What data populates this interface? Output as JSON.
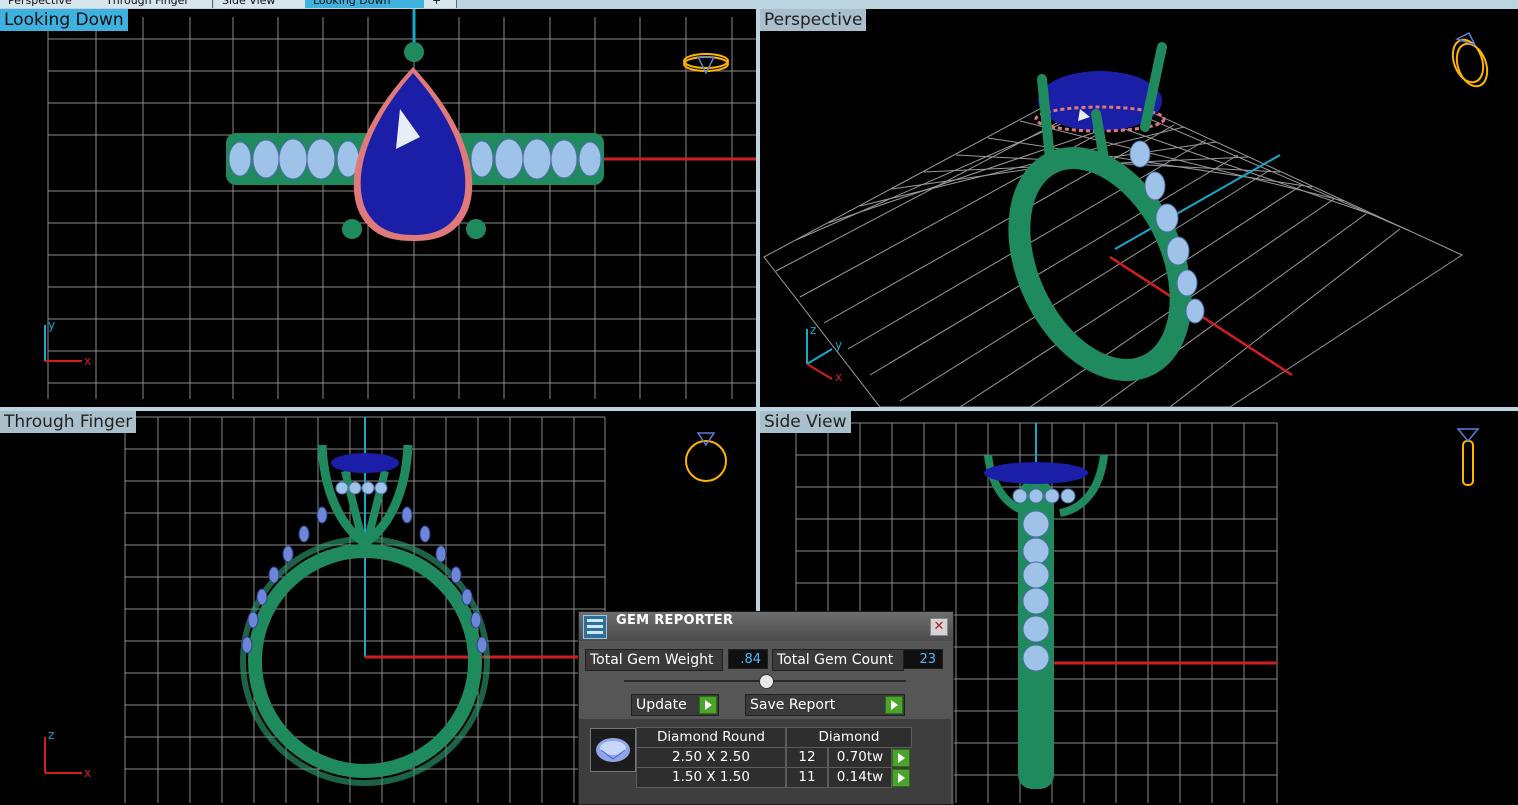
{
  "tabs": [
    {
      "label": "Perspective"
    },
    {
      "label": "Through Finger"
    },
    {
      "label": "Side View"
    },
    {
      "label": "Looking Down"
    },
    {
      "label": "+"
    }
  ],
  "viewports": {
    "top_left": {
      "label": "Looking Down"
    },
    "top_right": {
      "label": "Perspective"
    },
    "bottom_left": {
      "label": "Through Finger"
    },
    "bottom_right": {
      "label": "Side View"
    }
  },
  "axis_labels": {
    "x": "x",
    "y": "y",
    "z": "z"
  },
  "gem_reporter": {
    "title": "GEM REPORTER",
    "close": "✕",
    "total_weight_label": "Total Gem Weight",
    "total_weight_value": ".84",
    "total_count_label": "Total Gem Count",
    "total_count_value": "23",
    "update_label": "Update",
    "save_report_label": "Save Report",
    "header_shape": "Diamond Round",
    "header_material": "Diamond",
    "rows": [
      {
        "size": "2.50 X 2.50",
        "count": "12",
        "weight": "0.70tw"
      },
      {
        "size": "1.50 X 1.50",
        "count": "11",
        "weight": "0.14tw"
      }
    ]
  },
  "colors": {
    "accent": "#3fb1df",
    "grid": "#8a8a8a",
    "metal": "#1f8a5e",
    "sapphire": "#1b1fa8",
    "diamond": "#9fc2e8",
    "axis_x": "#d11f1f",
    "axis_y": "#1aa7c9",
    "gizmo": "#ffb400"
  }
}
